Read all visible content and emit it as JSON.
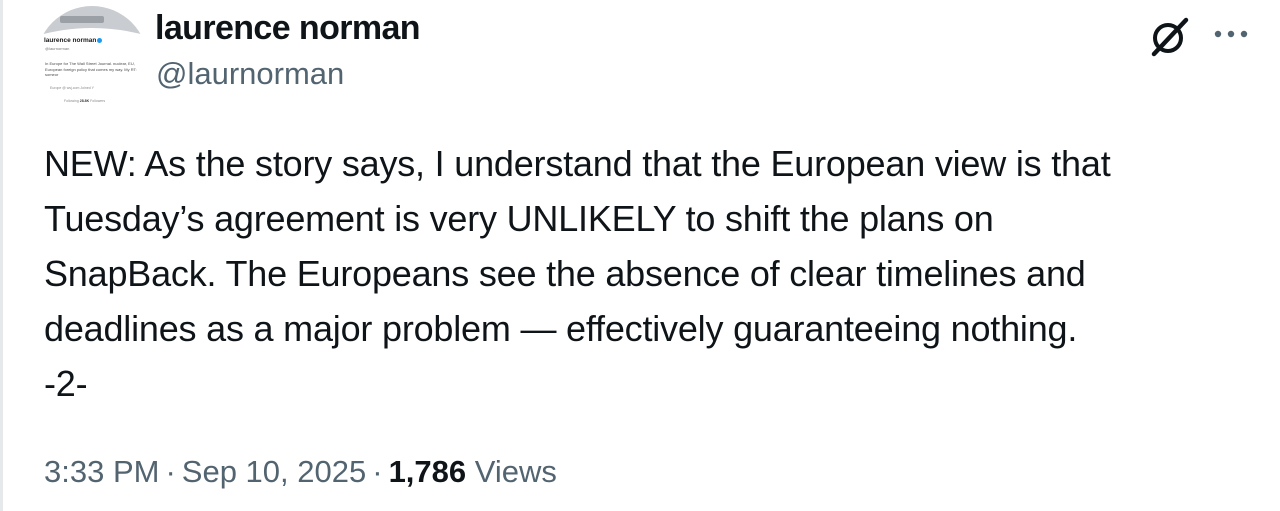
{
  "author": {
    "display_name": "laurence norman",
    "handle": "@laurnorman",
    "avatar": {
      "mini_name": "laurence norman",
      "mini_handle": "@laurnorman",
      "mini_bio": "In Europe for The Wall Street Journal. nuclear, EU, European foreign policy that comes my way. My RT: someor",
      "mini_meta": "Europe   @ wsj.com   Joined Y",
      "mini_following_label": "Following",
      "mini_followers_count": "28.8K",
      "mini_followers_label": "Followers"
    }
  },
  "header": {
    "grok_icon": "grok-slashed-circle-icon",
    "more_icon": "more-dots-icon"
  },
  "tweet": {
    "lines": [
      "NEW: As the story says, I understand that the European view is that",
      "Tuesday’s agreement is very UNLIKELY to shift the plans on",
      "SnapBack. The Europeans see the absence of clear timelines and",
      "deadlines as a major problem — effectively guaranteeing nothing.",
      "-2-"
    ]
  },
  "meta": {
    "time": "3:33 PM",
    "separator": "·",
    "date": "Sep 10, 2025",
    "views_count": "1,786",
    "views_label": "Views"
  },
  "colors": {
    "text_primary": "#0f1419",
    "text_secondary": "#536471",
    "verified_blue": "#1d9bf0"
  }
}
